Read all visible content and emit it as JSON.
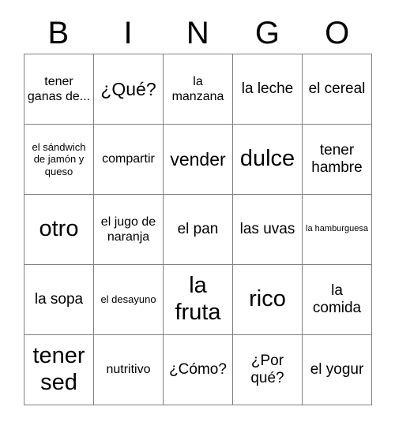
{
  "card": {
    "title": "BINGO",
    "header_letters": [
      "B",
      "I",
      "N",
      "G",
      "O"
    ],
    "grid": {
      "rows": 5,
      "columns": 5,
      "border_color": "#808080",
      "background_color": "#ffffff",
      "text_color": "#000000"
    },
    "cells": [
      {
        "text": "tener ganas de...",
        "size": "md"
      },
      {
        "text": "¿Qué?",
        "size": "xl"
      },
      {
        "text": "la manzana",
        "size": "md"
      },
      {
        "text": "la leche",
        "size": "lg"
      },
      {
        "text": "el cereal",
        "size": "lg"
      },
      {
        "text": "el sándwich de jamón y queso",
        "size": "sm"
      },
      {
        "text": "compartir",
        "size": "md"
      },
      {
        "text": "vender",
        "size": "xl"
      },
      {
        "text": "dulce",
        "size": "xxl"
      },
      {
        "text": "tener hambre",
        "size": "lg"
      },
      {
        "text": "otro",
        "size": "xxl"
      },
      {
        "text": "el jugo de naranja",
        "size": "md"
      },
      {
        "text": "el pan",
        "size": "lg"
      },
      {
        "text": "las uvas",
        "size": "lg"
      },
      {
        "text": "la hamburguesa",
        "size": "xs"
      },
      {
        "text": "la sopa",
        "size": "lg"
      },
      {
        "text": "el desayuno",
        "size": "sm"
      },
      {
        "text": "la fruta",
        "size": "xxl"
      },
      {
        "text": "rico",
        "size": "xxl"
      },
      {
        "text": "la comida",
        "size": "lg"
      },
      {
        "text": "tener sed",
        "size": "xxl"
      },
      {
        "text": "nutritivo",
        "size": "md"
      },
      {
        "text": "¿Cómo?",
        "size": "lg"
      },
      {
        "text": "¿Por qué?",
        "size": "lg"
      },
      {
        "text": "el yogur",
        "size": "lg"
      }
    ]
  }
}
